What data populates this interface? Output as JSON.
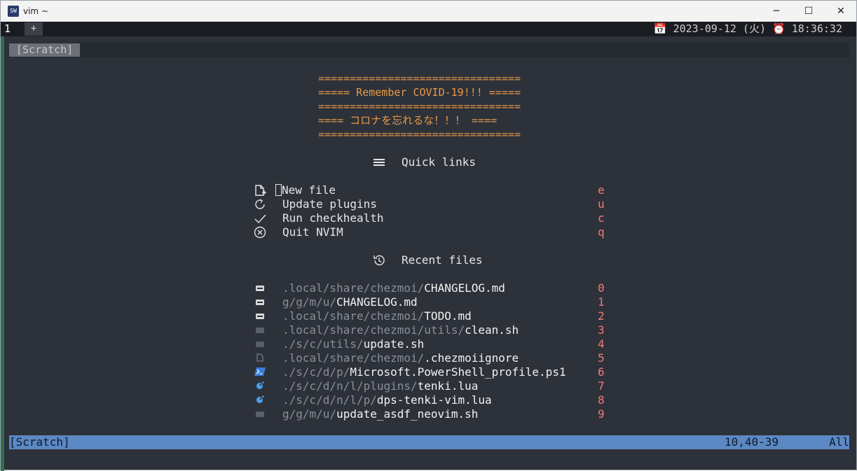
{
  "window": {
    "title": "vim ~",
    "icon_label": "SW",
    "minimize": "─",
    "maximize": "☐",
    "close": "✕"
  },
  "tabline": {
    "tab_number": "1",
    "new_tab": "+",
    "calendar_icon": "📅",
    "date": "2023-09-12 (火)",
    "alarm_icon": "⏰",
    "time": "18:36:32"
  },
  "buffer": {
    "name": "[Scratch]"
  },
  "banner": [
    "================================",
    "===== Remember COVID-19!!! =====",
    "================================",
    "==== コロナを忘れるな！！！ ====",
    "================================"
  ],
  "quick_links": {
    "heading_icon": "hamburger-icon",
    "heading": "Quick links",
    "items": [
      {
        "icon": "new-file-icon",
        "label": "New file",
        "key": "e"
      },
      {
        "icon": "refresh-icon",
        "label": "Update plugins",
        "key": "u"
      },
      {
        "icon": "check-icon",
        "label": "Run checkhealth",
        "key": "c"
      },
      {
        "icon": "close-circle-icon",
        "label": "Quit NVIM",
        "key": "q"
      }
    ]
  },
  "recent_files": {
    "heading_icon": "history-icon",
    "heading": "Recent files",
    "items": [
      {
        "icon": "markdown-icon",
        "dir": ".local/share/chezmoi/",
        "file": "CHANGELOG.md",
        "key": "0"
      },
      {
        "icon": "markdown-icon",
        "dir": "g/g/m/u/",
        "file": "CHANGELOG.md",
        "key": "1"
      },
      {
        "icon": "markdown-icon",
        "dir": ".local/share/chezmoi/",
        "file": "TODO.md",
        "key": "2"
      },
      {
        "icon": "shell-icon",
        "dir": ".local/share/chezmoi/utils/",
        "file": "clean.sh",
        "key": "3"
      },
      {
        "icon": "shell-icon",
        "dir": "./s/c/utils/",
        "file": "update.sh",
        "key": "4"
      },
      {
        "icon": "file-icon",
        "dir": ".local/share/chezmoi/",
        "file": ".chezmoiignore",
        "key": "5"
      },
      {
        "icon": "powershell-icon",
        "dir": "./s/c/d/p/",
        "file": "Microsoft.PowerShell_profile.ps1",
        "key": "6"
      },
      {
        "icon": "lua-icon",
        "dir": "./s/c/d/n/l/plugins/",
        "file": "tenki.lua",
        "key": "7"
      },
      {
        "icon": "lua-icon",
        "dir": "./s/c/d/n/l/p/",
        "file": "dps-tenki-vim.lua",
        "key": "8"
      },
      {
        "icon": "shell-icon",
        "dir": "g/g/m/u/",
        "file": "update_asdf_neovim.sh",
        "key": "9"
      }
    ]
  },
  "statusline": {
    "name": "[Scratch]",
    "position": "10,40-39",
    "scroll": "All"
  },
  "colors": {
    "banner": "#e89a4a",
    "key": "#f07a7a",
    "status_bg": "#5c88c4",
    "bg": "#2d3139"
  }
}
